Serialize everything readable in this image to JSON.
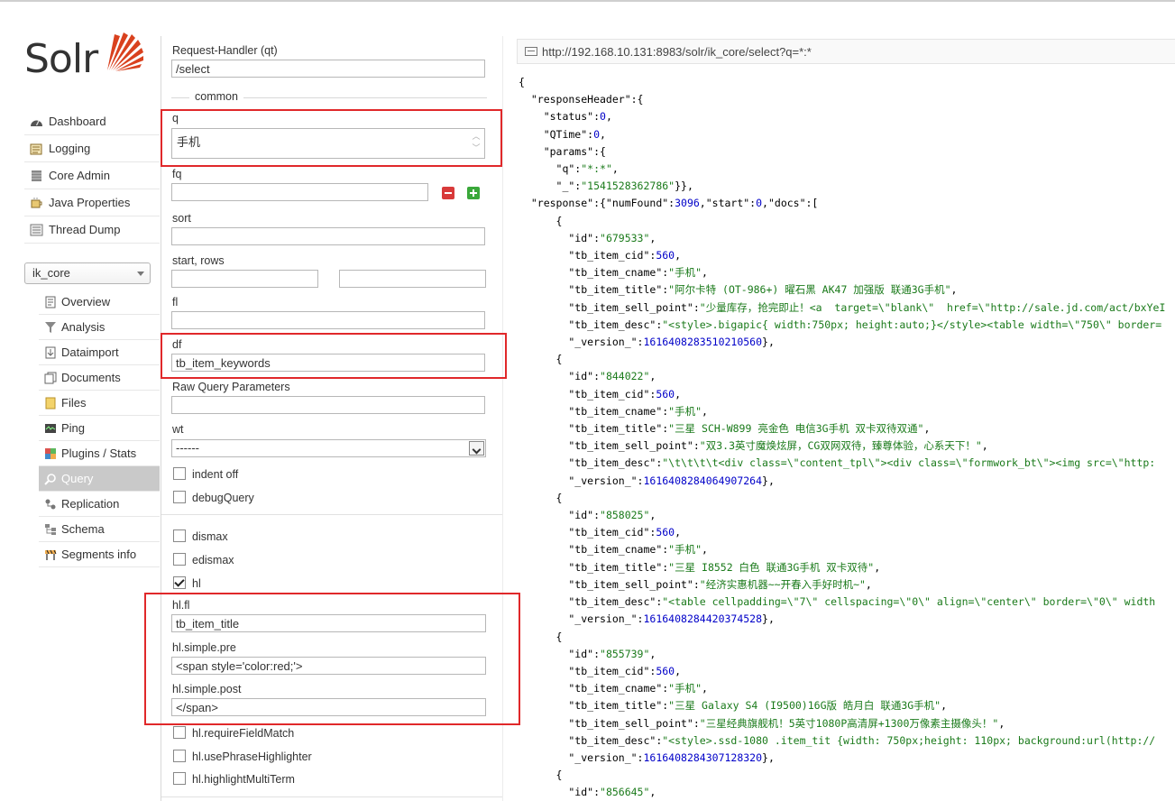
{
  "app": {
    "logo_text": "Solr"
  },
  "sidebar": {
    "items": [
      {
        "label": "Dashboard",
        "icon": "dashboard-icon"
      },
      {
        "label": "Logging",
        "icon": "logging-icon"
      },
      {
        "label": "Core Admin",
        "icon": "core-admin-icon"
      },
      {
        "label": "Java Properties",
        "icon": "java-properties-icon"
      },
      {
        "label": "Thread Dump",
        "icon": "thread-dump-icon"
      }
    ],
    "core_selector": "ik_core",
    "core_items": [
      {
        "label": "Overview",
        "icon": "overview-icon"
      },
      {
        "label": "Analysis",
        "icon": "analysis-icon"
      },
      {
        "label": "Dataimport",
        "icon": "dataimport-icon"
      },
      {
        "label": "Documents",
        "icon": "documents-icon"
      },
      {
        "label": "Files",
        "icon": "files-icon"
      },
      {
        "label": "Ping",
        "icon": "ping-icon"
      },
      {
        "label": "Plugins / Stats",
        "icon": "plugins-icon"
      },
      {
        "label": "Query",
        "icon": "query-icon",
        "active": true
      },
      {
        "label": "Replication",
        "icon": "replication-icon"
      },
      {
        "label": "Schema",
        "icon": "schema-icon"
      },
      {
        "label": "Segments info",
        "icon": "segments-icon"
      }
    ]
  },
  "form": {
    "qt_label": "Request-Handler (qt)",
    "qt_value": "/select",
    "common_legend": "common",
    "q_label": "q",
    "q_value": "手机",
    "fq_label": "fq",
    "fq_value": "",
    "sort_label": "sort",
    "sort_value": "",
    "start_rows_label": "start, rows",
    "start_value": "",
    "rows_value": "",
    "fl_label": "fl",
    "fl_value": "",
    "df_label": "df",
    "df_value": "tb_item_keywords",
    "raw_label": "Raw Query Parameters",
    "raw_value": "",
    "wt_label": "wt",
    "wt_value": "------",
    "indent_label": "indent off",
    "debug_label": "debugQuery",
    "dismax_label": "dismax",
    "edismax_label": "edismax",
    "hl_label": "hl",
    "hl_checked": true,
    "hlfl_label": "hl.fl",
    "hlfl_value": "tb_item_title",
    "pre_label": "hl.simple.pre",
    "pre_value": "<span style='color:red;'>",
    "post_label": "hl.simple.post",
    "post_value": "</span>",
    "rfm_label": "hl.requireFieldMatch",
    "uph_label": "hl.usePhraseHighlighter",
    "hmt_label": "hl.highlightMultiTerm"
  },
  "response": {
    "url": "http://192.168.10.131:8983/solr/ik_core/select?q=*:*",
    "header": {
      "status": "0",
      "qtime": "0",
      "q": "\"*:*\"",
      "underscore": "\"1541528362786\""
    },
    "numFound": "3096",
    "start": "0",
    "docs": [
      {
        "id": "\"679533\"",
        "cid": "560",
        "cname": "\"手机\"",
        "title": "\"阿尔卡特 (OT-986+) 曜石黑 AK47 加强版 联通3G手机\"",
        "sell_point": "\"少量库存，抢完即止！<a  target=\\\"blank\\\"  href=\\\"http://sale.jd.com/act/bxYeI",
        "desc": "\"<style>.bigapic{ width:750px; height:auto;}</style><table width=\\\"750\\\" border=",
        "version": "1616408283510210560"
      },
      {
        "id": "\"844022\"",
        "cid": "560",
        "cname": "\"手机\"",
        "title": "\"三星 SCH-W899 亮金色 电信3G手机 双卡双待双通\"",
        "sell_point": "\"双3.3英寸魔焕炫屏，CG双网双待，臻尊体验，心系天下！\"",
        "desc": "\"\\t\\t\\t\\t<div class=\\\"content_tpl\\\"><div class=\\\"formwork_bt\\\"><img src=\\\"http:",
        "version": "1616408284064907264"
      },
      {
        "id": "\"858025\"",
        "cid": "560",
        "cname": "\"手机\"",
        "title": "\"三星 I8552 白色 联通3G手机 双卡双待\"",
        "sell_point": "\"经济实惠机器~~开春入手好时机~\"",
        "desc": "\"<table cellpadding=\\\"7\\\" cellspacing=\\\"0\\\" align=\\\"center\\\" border=\\\"0\\\" width",
        "version": "1616408284420374528"
      },
      {
        "id": "\"855739\"",
        "cid": "560",
        "cname": "\"手机\"",
        "title": "\"三星 Galaxy S4 (I9500)16G版 皓月白 联通3G手机\"",
        "sell_point": "\"三星经典旗舰机！5英寸1080P高清屏+1300万像素主摄像头！\"",
        "desc": "\"<style>.ssd-1080 .item_tit {width: 750px;height: 110px; background:url(http://",
        "version": "1616408284307128320"
      },
      {
        "id": "\"856645\""
      }
    ]
  }
}
